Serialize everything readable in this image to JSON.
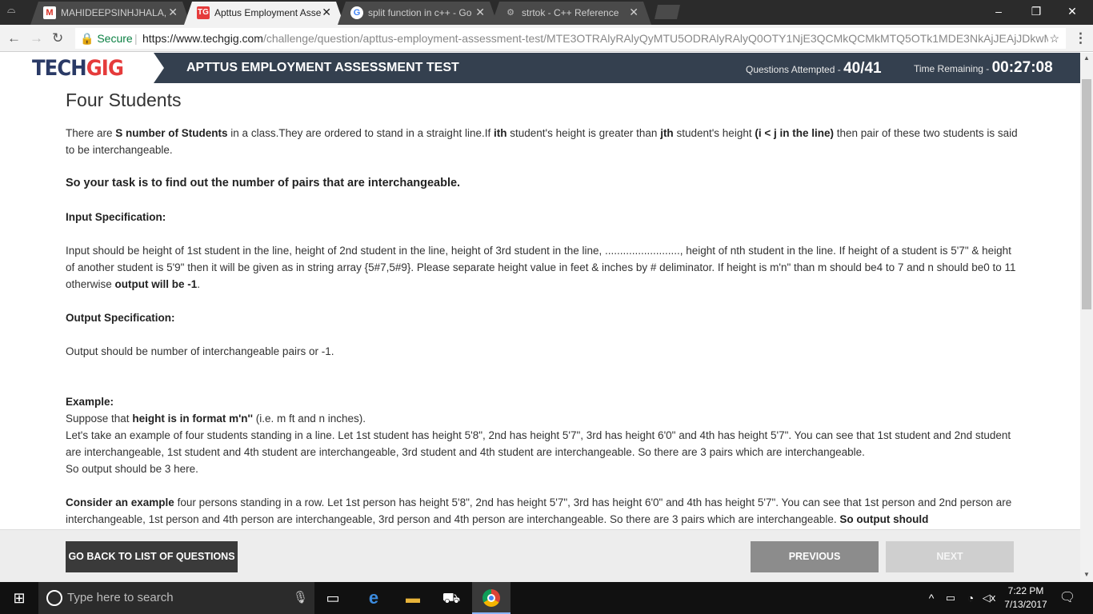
{
  "browser": {
    "tabs": [
      {
        "title": "MAHIDEEPSINHJHALA, A",
        "icon": "gmail-icon",
        "active": false
      },
      {
        "title": "Apttus Employment Asse",
        "icon": "techgig-icon",
        "active": true
      },
      {
        "title": "split function in c++ - Go",
        "icon": "google-icon",
        "active": false
      },
      {
        "title": "strtok - C++ Reference",
        "icon": "cplusplus-icon",
        "active": false
      }
    ],
    "secure_label": "Secure",
    "url_domain": "https://www.techgig.com",
    "url_path": "/challenge/question/apttus-employment-assessment-test/MTE3OTRAlyRAlyQyMTU5ODRAlyRAlyQ0OTY1NjE3QCMkQCMkMTQ5OTk1MDE3NkAjJEAjJDkwMz"
  },
  "header": {
    "logo_part1": "TECH",
    "logo_part2": "GIG",
    "test_title": "APTTUS EMPLOYMENT ASSESSMENT TEST",
    "attempted_label": "Questions Attempted - ",
    "attempted_value": "40/41",
    "time_label": "Time Remaining - ",
    "time_value": "00:27:08"
  },
  "question": {
    "title": "Four Students",
    "intro_1": "There are ",
    "intro_b1": "S number of Students",
    "intro_2": " in a class.They are ordered to stand in a straight line.If ",
    "intro_b2": "ith",
    "intro_3": " student's height is greater than ",
    "intro_b3": "jth",
    "intro_4": " student's height ",
    "intro_b4": "(i < j in the line)",
    "intro_5": " then pair of these two students is said to be interchangeable.",
    "task": "So your task is to find out the number of pairs that are interchangeable.",
    "input_heading": "Input Specification:",
    "input_text": "Input should be  height of 1st student in the line, height of 2nd student in the line, height of 3rd student in the line, ........................., height of nth student in the line. If height of a student is 5'7\" & height of another student is 5'9\" then it will be given as in string array  {5#7,5#9}. Please separate height value in feet & inches by # deliminator. If height is m'n\" than m should be4 to 7 and n should be0 to 11 otherwise ",
    "input_bold": "output will be  -1",
    "input_end": ".",
    "output_heading": "Output Specification:",
    "output_text": "Output should be number of interchangeable pairs or -1.",
    "example_heading": "Example:",
    "example_1a": "Suppose that ",
    "example_1b": "height is in format m'n''",
    "example_1c": " (i.e. m ft and n inches).",
    "example_2": "Let's take an example of four students standing in a line. Let 1st student has height 5'8\", 2nd has height 5'7\", 3rd has height 6'0\" and 4th has height 5'7\". You can see that 1st student and 2nd student are interchangeable, 1st student and 4th student are interchangeable, 3rd student and 4th student are interchangeable. So there are 3 pairs which are interchangeable.",
    "example_3": "So output should be 3 here.",
    "consider_bold": "Consider an example",
    "consider_text": " four persons standing in a row. Let 1st person has height 5'8\", 2nd has height 5'7\", 3rd has height 6'0\" and 4th has height 5'7\". You can see that 1st person and 2nd person are interchangeable, 1st person and 4th person are interchangeable, 3rd person and 4th person are interchangeable. So there are 3 pairs which are interchangeable. ",
    "consider_end_bold": "So output should"
  },
  "footer": {
    "back_label": "GO BACK TO LIST OF QUESTIONS",
    "previous_label": "PREVIOUS",
    "next_label": "NEXT"
  },
  "taskbar": {
    "search_placeholder": "Type here to search",
    "time": "7:22 PM",
    "date": "7/13/2017"
  },
  "colors": {
    "header_bg": "#34404f",
    "logo_tech": "#2a3a66",
    "logo_gig": "#e53b3b",
    "back_button": "#3a3a3a",
    "previous_button": "#8c8c8c",
    "next_button_disabled": "#cfcfcf"
  }
}
